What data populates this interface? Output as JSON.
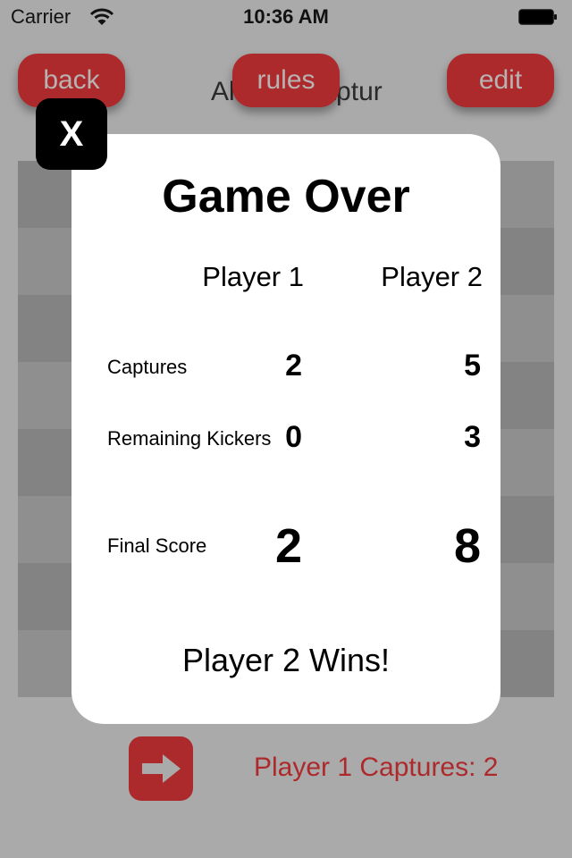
{
  "status_bar": {
    "carrier": "Carrier",
    "time": "10:36 AM",
    "wifi_icon": "wifi-icon",
    "battery_icon": "battery-icon"
  },
  "header": {
    "title_visible": "Al      2 Captur",
    "back_label": "back",
    "rules_label": "rules",
    "edit_label": "edit"
  },
  "board": {
    "rows": 8,
    "cols": 8,
    "colors": {
      "dark": "#838383",
      "light": "#8f8f8f"
    }
  },
  "modal": {
    "close_label": "X",
    "title": "Game Over",
    "players": [
      "Player 1",
      "Player 2"
    ],
    "rows": [
      {
        "label": "Captures",
        "values": [
          "2",
          "5"
        ]
      },
      {
        "label": "Remaining Kickers",
        "values": [
          "0",
          "3"
        ]
      },
      {
        "label": "Final Score",
        "values": [
          "2",
          "8"
        ]
      }
    ],
    "result": "Player 2 Wins!"
  },
  "footer": {
    "next_icon": "arrow-right-icon",
    "status": "Player 1 Captures: 2"
  },
  "colors": {
    "accent": "#ad2a2c",
    "background": "#aaaaaa",
    "modal_bg": "#ffffff"
  }
}
